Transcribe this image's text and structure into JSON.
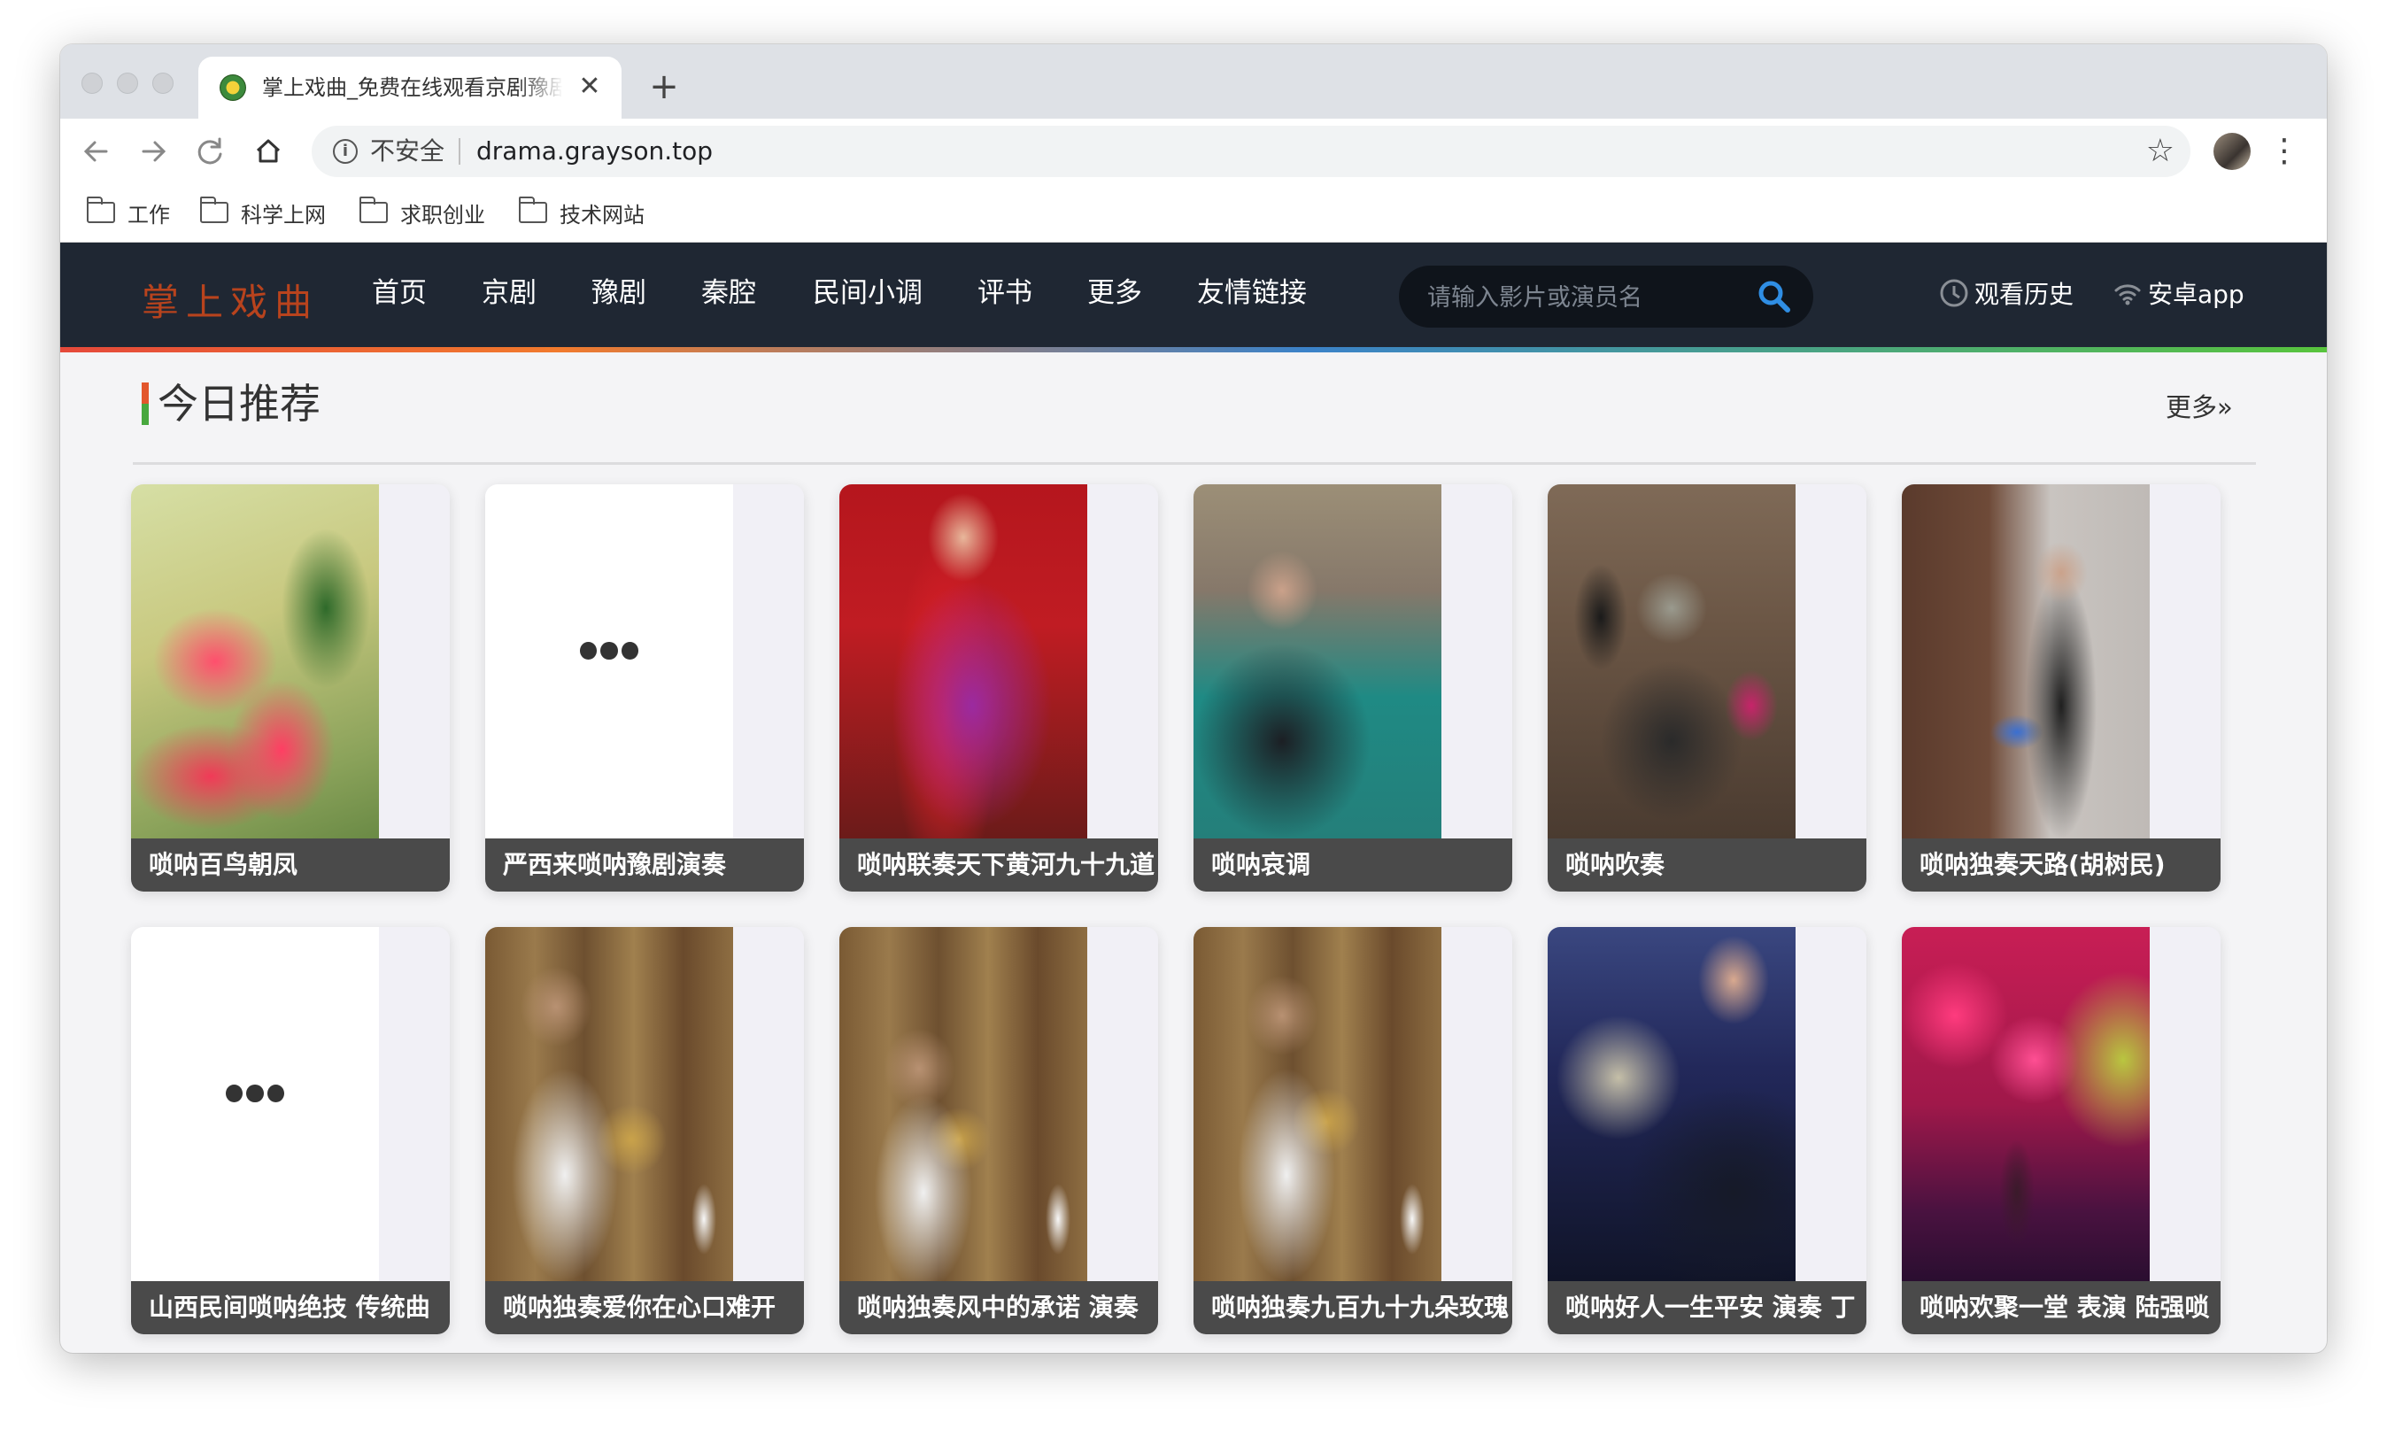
{
  "browser": {
    "tab_title": "掌上戏曲_免费在线观看京剧豫剧",
    "tab_close": "✕",
    "new_tab": "+",
    "security_label": "不安全",
    "url": "drama.grayson.top",
    "bookmarks": [
      "工作",
      "科学上网",
      "求职创业",
      "技术网站"
    ]
  },
  "site": {
    "logo": "掌上戏曲",
    "nav": [
      "首页",
      "京剧",
      "豫剧",
      "秦腔",
      "民间小调",
      "评书",
      "更多",
      "友情链接"
    ],
    "search_placeholder": "请输入影片或演员名",
    "history_label": "观看历史",
    "app_label": "安卓app"
  },
  "section": {
    "title": "今日推荐",
    "more": "更多»"
  },
  "cards": [
    {
      "label": "唢呐百鸟朝凤",
      "thumb": "flower"
    },
    {
      "label": "严西来唢呐豫剧演奏",
      "thumb": "loading"
    },
    {
      "label": "唢呐联奏天下黄河九十九道",
      "thumb": "red-stage"
    },
    {
      "label": "唢呐哀调",
      "thumb": "outdoor"
    },
    {
      "label": "唢呐吹奏",
      "thumb": "band"
    },
    {
      "label": "唢呐独奏天路(胡树民)",
      "thumb": "hall"
    },
    {
      "label": "山西民间唢呐绝技 传统曲",
      "thumb": "loading"
    },
    {
      "label": "唢呐独奏爱你在心口难开",
      "thumb": "curtain"
    },
    {
      "label": "唢呐独奏风中的承诺 演奏",
      "thumb": "curtain"
    },
    {
      "label": "唢呐独奏九百九十九朵玫瑰",
      "thumb": "curtain"
    },
    {
      "label": "唢呐好人一生平安 演奏 丁",
      "thumb": "dark-stage"
    },
    {
      "label": "唢呐欢聚一堂 表演 陆强唢",
      "thumb": "red-roses"
    }
  ],
  "colors": {
    "header_bg": "#1f2733",
    "logo": "#b8431d",
    "card_label_bg": "#4a4a4a"
  }
}
